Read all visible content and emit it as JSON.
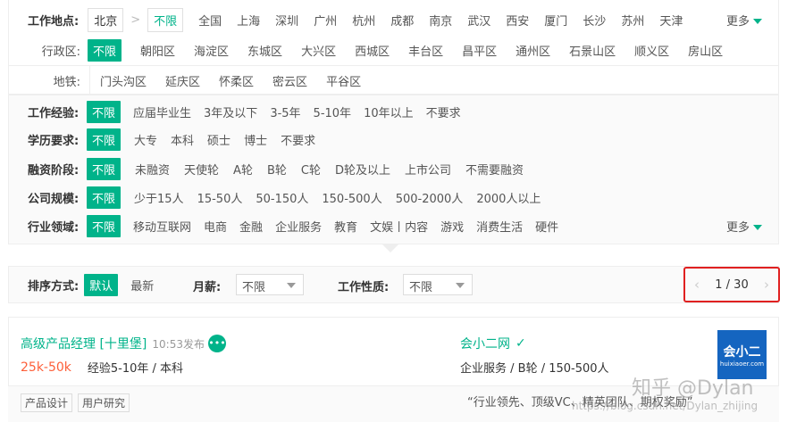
{
  "location": {
    "label": "工作地点:",
    "current_city": "北京",
    "cities": [
      "不限",
      "全国",
      "上海",
      "深圳",
      "广州",
      "杭州",
      "成都",
      "南京",
      "武汉",
      "西安",
      "厦门",
      "长沙",
      "苏州",
      "天津"
    ],
    "more": "更多"
  },
  "district": {
    "label": "行政区:",
    "items_row1": [
      "不限",
      "朝阳区",
      "海淀区",
      "东城区",
      "大兴区",
      "西城区",
      "丰台区",
      "昌平区",
      "通州区",
      "石景山区",
      "顺义区",
      "房山区"
    ],
    "items_row2": [
      "门头沟区",
      "延庆区",
      "怀柔区",
      "密云区",
      "平谷区"
    ],
    "subway_label": "地铁:"
  },
  "filters": {
    "experience": {
      "label": "工作经验:",
      "items": [
        "不限",
        "应届毕业生",
        "3年及以下",
        "3-5年",
        "5-10年",
        "10年以上",
        "不要求"
      ]
    },
    "education": {
      "label": "学历要求:",
      "items": [
        "不限",
        "大专",
        "本科",
        "硕士",
        "博士",
        "不要求"
      ]
    },
    "funding": {
      "label": "融资阶段:",
      "items": [
        "不限",
        "未融资",
        "天使轮",
        "A轮",
        "B轮",
        "C轮",
        "D轮及以上",
        "上市公司",
        "不需要融资"
      ]
    },
    "size": {
      "label": "公司规模:",
      "items": [
        "不限",
        "少于15人",
        "15-50人",
        "50-150人",
        "150-500人",
        "500-2000人",
        "2000人以上"
      ]
    },
    "industry": {
      "label": "行业领域:",
      "items": [
        "不限",
        "移动互联网",
        "电商",
        "金融",
        "企业服务",
        "教育",
        "文娱丨内容",
        "游戏",
        "消费生活",
        "硬件"
      ],
      "more": "更多"
    }
  },
  "sort": {
    "label": "排序方式:",
    "options": [
      "默认",
      "最新"
    ],
    "salary_label": "月薪:",
    "salary_value": "不限",
    "jobtype_label": "工作性质:",
    "jobtype_value": "不限",
    "pager": "1 / 30"
  },
  "job": {
    "title": "高级产品经理 [十里堡]",
    "posted": "10:53发布",
    "salary": "25k-50k",
    "requirement": "经验5-10年 / 本科",
    "company": "会小二网",
    "company_info": "企业服务 / B轮 / 150-500人",
    "tags": [
      "产品设计",
      "用户研究"
    ],
    "slogan": "“行业领先、顶级VC、精英团队、期权奖励”",
    "logo_text": "会小二",
    "logo_sub": "huixiaoer.com"
  },
  "watermark": {
    "main": "知乎 @Dylan",
    "sub": "https://blog.csdn.net/Dylan_zhijing"
  },
  "colors": {
    "accent": "#00b38a",
    "salary": "#fd5f39",
    "highlight_border": "#e02020",
    "logo_bg": "#1565c0"
  }
}
